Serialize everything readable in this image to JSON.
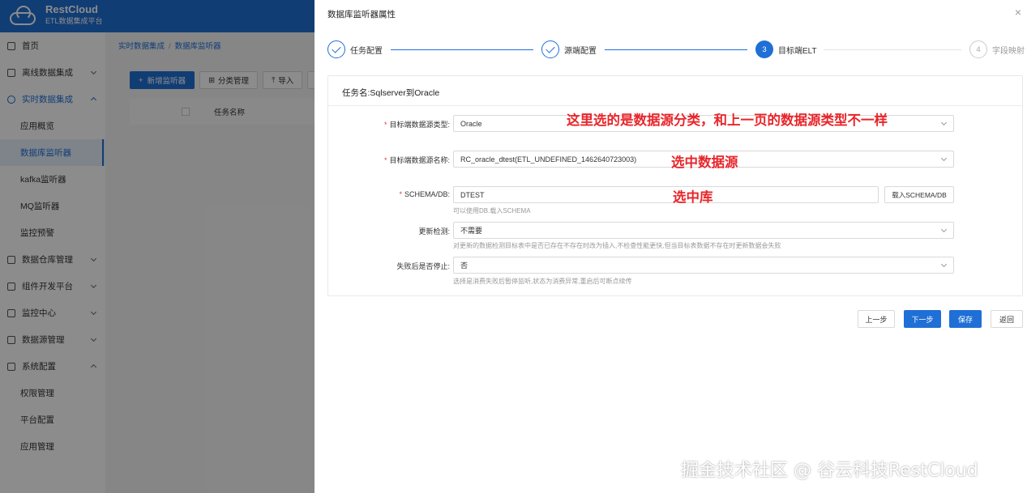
{
  "app": {
    "logo_title": "RestCloud",
    "logo_subtitle": "ETL数据集成平台"
  },
  "sidebar": {
    "items": [
      {
        "label": "首页",
        "icon": "home-icon"
      },
      {
        "label": "离线数据集成",
        "icon": "offline-icon"
      },
      {
        "label": "实时数据集成",
        "icon": "realtime-icon"
      },
      {
        "label": "应用概览"
      },
      {
        "label": "数据库监听器"
      },
      {
        "label": "kafka监听器"
      },
      {
        "label": "MQ监听器"
      },
      {
        "label": "监控预警"
      },
      {
        "label": "数据仓库管理",
        "icon": "warehouse-icon"
      },
      {
        "label": "组件开发平台",
        "icon": "component-icon"
      },
      {
        "label": "监控中心",
        "icon": "monitor-icon"
      },
      {
        "label": "数据源管理",
        "icon": "datasource-icon"
      },
      {
        "label": "系统配置",
        "icon": "settings-icon"
      },
      {
        "label": "权限管理"
      },
      {
        "label": "平台配置"
      },
      {
        "label": "应用管理"
      }
    ]
  },
  "breadcrumb": {
    "first": "实时数据集成",
    "second": "数据库监听器"
  },
  "toolbar": {
    "new_label": "新增监听器",
    "category_label": "分类管理",
    "import_label": "导入",
    "export_label": "导"
  },
  "table": {
    "col_task_name": "任务名称"
  },
  "drawer": {
    "title": "数据库监听器属性",
    "close_icon": "close-icon",
    "steps": [
      {
        "label": "任务配置",
        "status": "done"
      },
      {
        "label": "源端配置",
        "status": "done"
      },
      {
        "label": "目标端ELT",
        "status": "current",
        "number": "3"
      },
      {
        "label": "字段映射",
        "status": "todo",
        "number": "4"
      }
    ],
    "task_name": "任务名:Sqlserver到Oracle",
    "form": {
      "target_type_label": "目标端数据源类型:",
      "target_type_value": "Oracle",
      "target_name_label": "目标端数据源名称:",
      "target_name_value": "RC_oracle_dtest(ETL_UNDEFINED_1462640723003)",
      "schema_label": "SCHEMA/DB:",
      "schema_value": "DTEST",
      "schema_hint": "可以使用DB.载入SCHEMA",
      "load_schema_label": "载入SCHEMA/DB",
      "update_check_label": "更新检测:",
      "update_check_value": "不需要",
      "update_check_hint": "对更新的数据检测目标表中是否已存在不存在时改为插入,不检查性能更快,但当目标表数据不存在时更新数据会失败",
      "stop_on_fail_label": "失败后是否停止:",
      "stop_on_fail_value": "否",
      "stop_on_fail_hint": "选择是消费失败后暂停监听,状态为消费异常,重启后可断点续传"
    },
    "annotations": {
      "type_note": "这里选的是数据源分类，和上一页的数据源类型不一样",
      "name_note": "选中数据源",
      "schema_note": "选中库"
    },
    "footer": {
      "prev": "上一步",
      "next": "下一步",
      "save": "保存",
      "back": "返回"
    }
  },
  "watermark": "掘金技术社区 @ 谷云科技RestCloud",
  "colors": {
    "primary": "#1f6fd6",
    "annotation": "#e8262b",
    "required": "#e53935"
  }
}
